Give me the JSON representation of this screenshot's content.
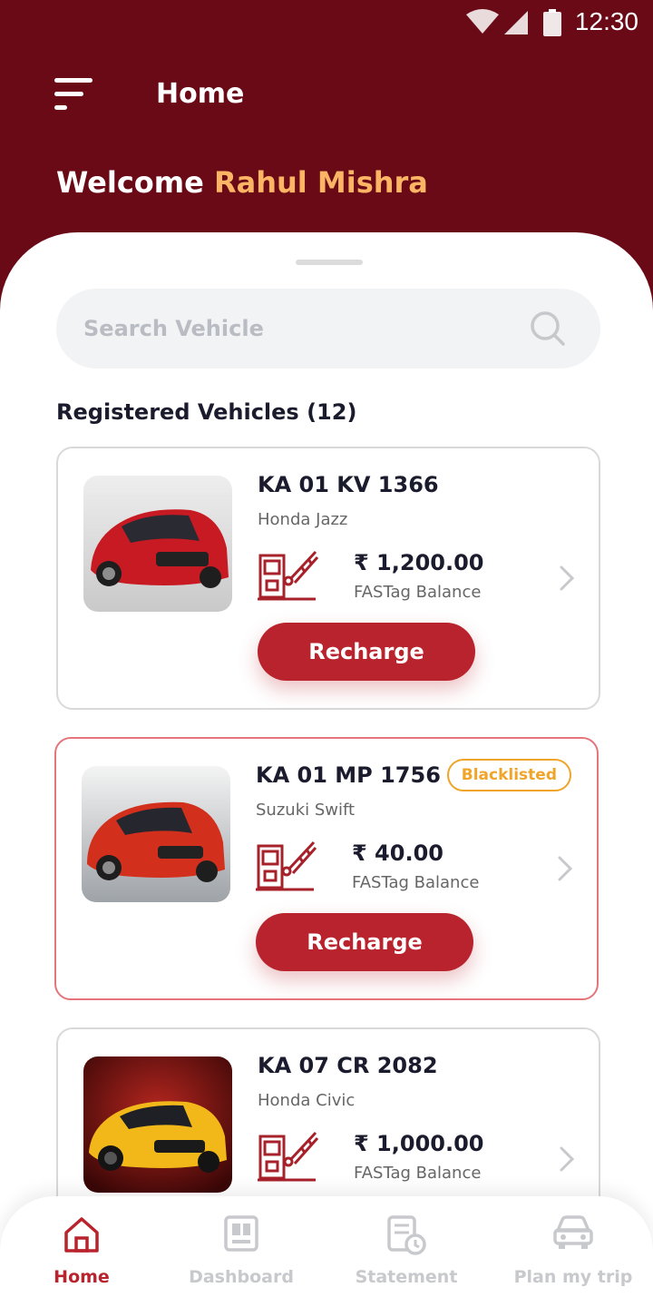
{
  "status_bar": {
    "time": "12:30"
  },
  "app_bar": {
    "title": "Home"
  },
  "welcome": {
    "prefix": "Welcome",
    "name": "Rahul Mishra"
  },
  "search": {
    "placeholder": "Search Vehicle"
  },
  "vehicles_section": {
    "title": "Registered Vehicles (12)"
  },
  "vehicles": [
    {
      "plate": "KA 01 KV 1366",
      "model": "Honda Jazz",
      "balance": "₹ 1,200.00",
      "balance_label": "FASTag Balance",
      "recharge_label": "Recharge",
      "car_color": "#c81a22"
    },
    {
      "plate": "KA 01 MP 1756",
      "model": "Suzuki Swift",
      "balance": "₹ 40.00",
      "balance_label": "FASTag Balance",
      "recharge_label": "Recharge",
      "badge": "Blacklisted",
      "car_color": "#d2301c"
    },
    {
      "plate": "KA 07 CR 2082",
      "model": "Honda Civic",
      "balance": "₹ 1,000.00",
      "balance_label": "FASTag Balance",
      "car_color": "#f2b81a"
    }
  ],
  "bottom_nav": [
    {
      "label": "Home",
      "icon": "home-icon",
      "active": true
    },
    {
      "label": "Dashboard",
      "icon": "dashboard-icon"
    },
    {
      "label": "Statement",
      "icon": "statement-icon"
    },
    {
      "label": "Plan my trip",
      "icon": "car-icon"
    }
  ],
  "colors": {
    "header_bg": "#6b0a17",
    "accent": "#b9232d",
    "name_highlight": "#fbb565",
    "badge": "#f0a42a"
  }
}
